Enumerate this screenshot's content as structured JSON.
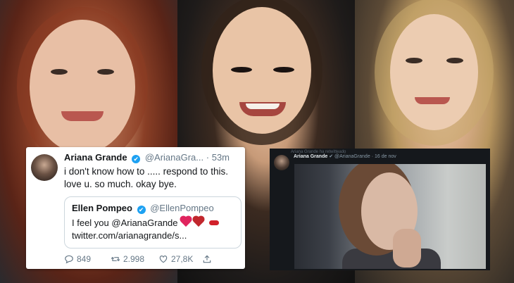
{
  "photos": [
    {
      "label": "photo-left"
    },
    {
      "label": "photo-center"
    },
    {
      "label": "photo-right"
    }
  ],
  "tweet": {
    "author_name": "Ariana Grande",
    "author_handle": "@ArianaGra...",
    "dot": "·",
    "time": "53m",
    "text": "i don't know how to ..... respond to this. love u. so much. okay bye.",
    "quote": {
      "author_name": "Ellen Pompeo",
      "author_handle": "@EllenPompeo",
      "line1": "I feel you @ArianaGrande",
      "line2": "twitter.com/arianagrande/s..."
    },
    "replies": "849",
    "retweets": "2.998",
    "likes": "27,8K"
  },
  "dark_tweet": {
    "retweeted_by": "Ariana Grande ha retwitteado",
    "author_name": "Ariana Grande",
    "verified": "✔",
    "author_handle": "@ArianaGrande",
    "dot": "·",
    "date": "16 de nov"
  }
}
